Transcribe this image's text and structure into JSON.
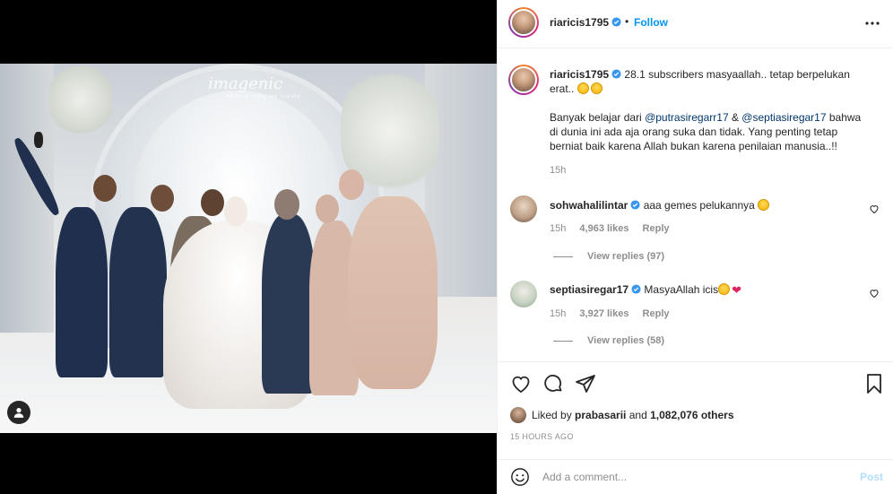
{
  "post": {
    "author": "riaricis1795",
    "follow_label": "Follow",
    "dot": "•",
    "watermark": "imagenic",
    "watermark_sub": "when a story we create"
  },
  "caption": {
    "username": "riaricis1795",
    "text1": "28.1 subscribers masyaallah.. tetap berpelukan erat..",
    "text2_prefix": "Banyak belajar dari ",
    "mention1": "@putrasiregarr17",
    "amp": " & ",
    "mention2": "@septiasiregar17",
    "text2_suffix": " bahwa di dunia ini ada aja orang suka dan tidak. Yang penting tetap berniat baik karena Allah bukan karena penilaian manusia..!!",
    "time": "15h"
  },
  "comments": [
    {
      "username": "sohwahalilintar",
      "text": "aaa gemes pelukannya",
      "time": "15h",
      "likes": "4,963 likes",
      "reply": "Reply",
      "view_replies": "View replies (97)"
    },
    {
      "username": "septiasiregar17",
      "text": "MasyaAllah icis",
      "time": "15h",
      "likes": "3,927 likes",
      "reply": "Reply",
      "view_replies": "View replies (58)"
    }
  ],
  "likes": {
    "prefix": "Liked by ",
    "user": "prabasarii",
    "mid": " and ",
    "count": "1,082,076 others"
  },
  "timestamp": "15 HOURS AGO",
  "add_comment": {
    "placeholder": "Add a comment...",
    "post_label": "Post"
  },
  "colors": {
    "accent": "#0095f6",
    "mention": "#00376b",
    "muted": "#8e8e8e",
    "post_disabled": "#b2dffc"
  }
}
